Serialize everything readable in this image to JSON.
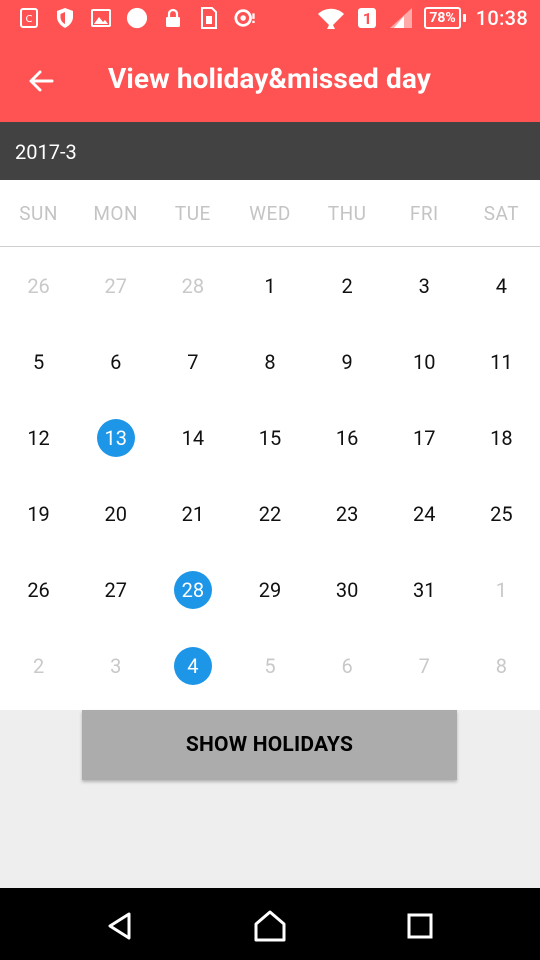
{
  "status_bar": {
    "time": "10:38",
    "battery_percent": "78%",
    "sim_badge": "1",
    "icons_left": [
      "notification-c-icon",
      "shield-icon",
      "image-icon",
      "circle-icon",
      "lock-icon",
      "sim-card-icon",
      "record-icon"
    ],
    "icons_right": [
      "wifi-icon",
      "sim-badge-icon",
      "signal-icon",
      "battery-icon"
    ]
  },
  "app_bar": {
    "title": "View holiday&missed day",
    "background": "#ff5252"
  },
  "calendar": {
    "month_label": "2017-3",
    "weekdays": [
      "SUN",
      "MON",
      "TUE",
      "WED",
      "THU",
      "FRI",
      "SAT"
    ],
    "selected_color": "#1e96e8",
    "weeks": [
      [
        {
          "d": "26",
          "other": true
        },
        {
          "d": "27",
          "other": true
        },
        {
          "d": "28",
          "other": true
        },
        {
          "d": "1"
        },
        {
          "d": "2"
        },
        {
          "d": "3"
        },
        {
          "d": "4"
        }
      ],
      [
        {
          "d": "5"
        },
        {
          "d": "6"
        },
        {
          "d": "7"
        },
        {
          "d": "8"
        },
        {
          "d": "9"
        },
        {
          "d": "10"
        },
        {
          "d": "11"
        }
      ],
      [
        {
          "d": "12"
        },
        {
          "d": "13",
          "selected": true
        },
        {
          "d": "14"
        },
        {
          "d": "15"
        },
        {
          "d": "16"
        },
        {
          "d": "17"
        },
        {
          "d": "18"
        }
      ],
      [
        {
          "d": "19"
        },
        {
          "d": "20"
        },
        {
          "d": "21"
        },
        {
          "d": "22"
        },
        {
          "d": "23"
        },
        {
          "d": "24"
        },
        {
          "d": "25"
        }
      ],
      [
        {
          "d": "26"
        },
        {
          "d": "27"
        },
        {
          "d": "28",
          "selected": true
        },
        {
          "d": "29"
        },
        {
          "d": "30"
        },
        {
          "d": "31"
        },
        {
          "d": "1",
          "other": true
        }
      ],
      [
        {
          "d": "2",
          "other": true
        },
        {
          "d": "3",
          "other": true
        },
        {
          "d": "4",
          "other": true,
          "selected": true
        },
        {
          "d": "5",
          "other": true
        },
        {
          "d": "6",
          "other": true
        },
        {
          "d": "7",
          "other": true
        },
        {
          "d": "8",
          "other": true
        }
      ]
    ]
  },
  "actions": {
    "show_holidays_label": "SHOW HOLIDAYS"
  },
  "nav_bar": {
    "buttons": [
      "back-triangle-icon",
      "home-icon",
      "recents-square-icon"
    ]
  }
}
